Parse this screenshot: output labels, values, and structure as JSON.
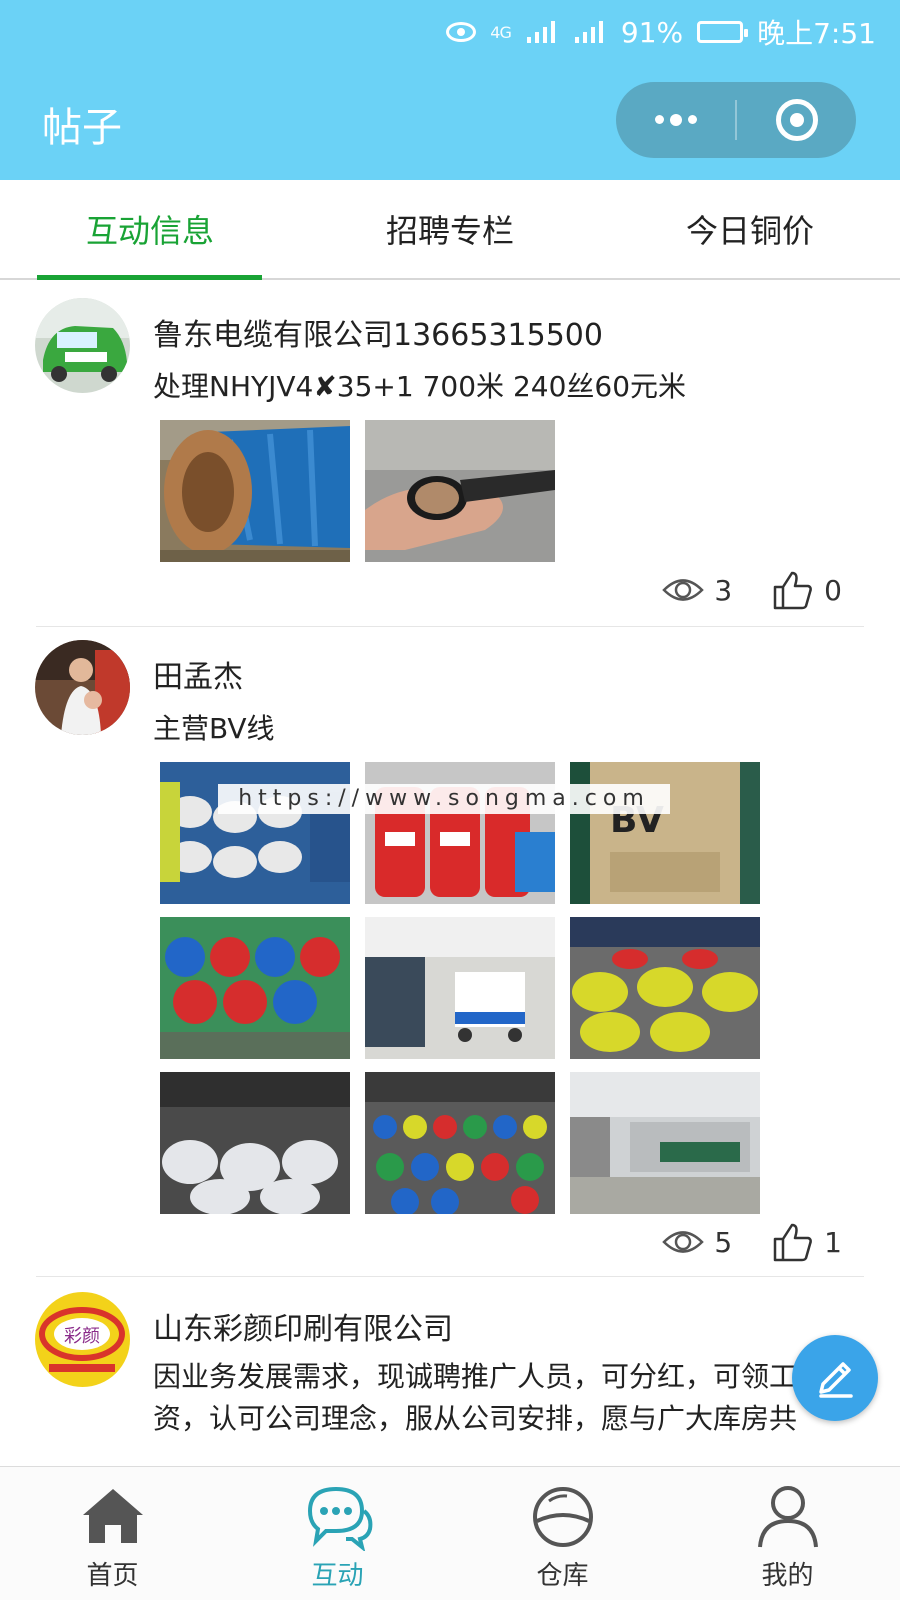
{
  "status_bar": {
    "network": "4G",
    "battery": "91%",
    "time": "晚上7:51"
  },
  "header": {
    "title": "帖子"
  },
  "tabs": [
    {
      "label": "互动信息",
      "active": true
    },
    {
      "label": "招聘专栏",
      "active": false
    },
    {
      "label": "今日铜价",
      "active": false
    }
  ],
  "posts": [
    {
      "author": "鲁东电缆有限公司13665315500",
      "content": "处理NHYJV4✘35+1 700米 240丝60元米",
      "views": "3",
      "likes": "0",
      "image_count": 2
    },
    {
      "author": "田孟杰",
      "content": "主营BV线",
      "views": "5",
      "likes": "1",
      "image_count": 9,
      "watermark": "https://www.songma.com"
    },
    {
      "author": "山东彩颜印刷有限公司",
      "content": "因业务发展需求，现诚聘推广人员，可分红，可领工资，认可公司理念，服从公司安排，愿与广大库房共",
      "avatar_text": "彩颜"
    }
  ],
  "bottom_nav": [
    {
      "label": "首页",
      "icon": "home-icon",
      "active": false
    },
    {
      "label": "互动",
      "icon": "chat-icon",
      "active": true
    },
    {
      "label": "仓库",
      "icon": "warehouse-icon",
      "active": false
    },
    {
      "label": "我的",
      "icon": "user-icon",
      "active": false
    }
  ],
  "colors": {
    "header": "#6bd2f6",
    "tab_active": "#19a335",
    "nav_active": "#2aa3b5",
    "fab": "#3aa4e9"
  }
}
